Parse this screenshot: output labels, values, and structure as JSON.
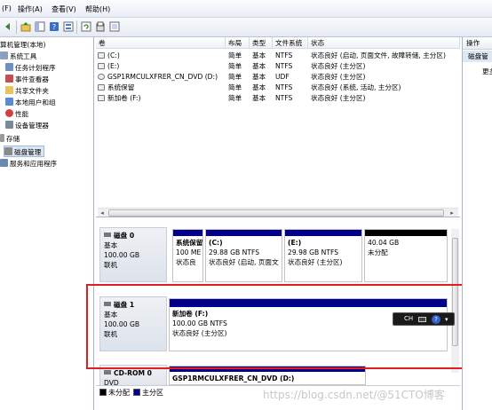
{
  "menubar": {
    "items": [
      "(F)",
      "操作(A)",
      "查看(V)",
      "帮助(H)"
    ]
  },
  "tree": {
    "root": "算机管理(本地)",
    "items": [
      {
        "label": "系统工具",
        "icon": "tools-icon"
      },
      {
        "label": "任务计划程序",
        "icon": "task-scheduler-icon"
      },
      {
        "label": "事件查看器",
        "icon": "event-viewer-icon"
      },
      {
        "label": "共享文件夹",
        "icon": "shared-folder-icon"
      },
      {
        "label": "本地用户和组",
        "icon": "users-icon"
      },
      {
        "label": "性能",
        "icon": "performance-icon"
      },
      {
        "label": "设备管理器",
        "icon": "device-manager-icon"
      }
    ],
    "storage": "存储",
    "disk_mgmt": "磁盘管理",
    "services": "服务和应用程序"
  },
  "volume_list": {
    "columns": [
      "卷",
      "布局",
      "类型",
      "文件系统",
      "状态"
    ],
    "rows": [
      {
        "vol": "(C:)",
        "layout": "简单",
        "type": "基本",
        "fs": "NTFS",
        "status": "状态良好 (启动, 页面文件, 故障转储, 主分区)"
      },
      {
        "vol": "(E:)",
        "layout": "简单",
        "type": "基本",
        "fs": "NTFS",
        "status": "状态良好 (主分区)"
      },
      {
        "vol": "GSP1RMCULXFRER_CN_DVD (D:)",
        "layout": "简单",
        "type": "基本",
        "fs": "UDF",
        "status": "状态良好 (主分区)"
      },
      {
        "vol": "系统保留",
        "layout": "简单",
        "type": "基本",
        "fs": "NTFS",
        "status": "状态良好 (系统, 活动, 主分区)"
      },
      {
        "vol": "新加卷 (F:)",
        "layout": "简单",
        "type": "基本",
        "fs": "NTFS",
        "status": "状态良好 (主分区)"
      }
    ]
  },
  "disks": {
    "disk0": {
      "name": "磁盘 0",
      "type": "基本",
      "size": "100.00 GB",
      "state": "联机",
      "partitions": [
        {
          "name": "系统保留",
          "size": "100 ME",
          "status": "状态良"
        },
        {
          "name": "(C:)",
          "size": "29.88 GB NTFS",
          "status": "状态良好 (启动, 页面文"
        },
        {
          "name": "(E:)",
          "size": "29.98 GB NTFS",
          "status": "状态良好 (主分区)"
        },
        {
          "name": "",
          "size": "40.04 GB",
          "status": "未分配"
        }
      ]
    },
    "disk1": {
      "name": "磁盘 1",
      "type": "基本",
      "size": "100.00 GB",
      "state": "联机",
      "partition": {
        "name": "新加卷  (F:)",
        "size": "100.00 GB NTFS",
        "status": "状态良好 (主分区)"
      }
    },
    "cdrom0": {
      "name": "CD-ROM 0",
      "type": "DVD",
      "partition": {
        "name": "GSP1RMCULXFRER_CN_DVD  (D:)"
      }
    }
  },
  "legend": {
    "unallocated": "未分配",
    "primary": "主分区"
  },
  "ops": {
    "header": "操作",
    "sub": "磁盘管",
    "more": "更多"
  },
  "langbar": {
    "label": "CH"
  },
  "watermark": "https://blog.csdn.net/@51CTO博客",
  "colors": {
    "primary_partition": "#00008b",
    "unallocated": "#000000",
    "highlight_box": "#e02020"
  }
}
